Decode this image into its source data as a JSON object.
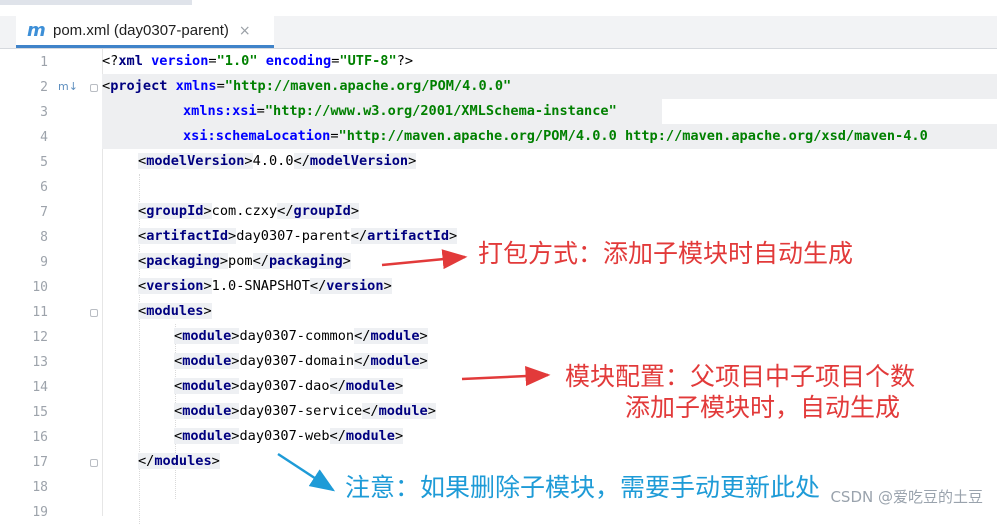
{
  "tab": {
    "icon": "maven-m-icon",
    "title": "pom.xml (day0307-parent)",
    "close": "×"
  },
  "line_numbers": [
    "1",
    "2",
    "3",
    "4",
    "5",
    "6",
    "7",
    "8",
    "9",
    "10",
    "11",
    "12",
    "13",
    "14",
    "15",
    "16",
    "17",
    "18",
    "19"
  ],
  "gutter_marker": "m↓",
  "code": {
    "l1": {
      "open": "<?",
      "name": "xml",
      "a1": "version",
      "v1": "\"1.0\"",
      "a2": "encoding",
      "v2": "\"UTF-8\"",
      "close": "?>"
    },
    "l2": {
      "tag": "project",
      "attr": "xmlns",
      "val": "\"http://maven.apache.org/POM/4.0.0\""
    },
    "l3": {
      "attr": "xmlns:xsi",
      "val": "\"http://www.w3.org/2001/XMLSchema-instance\""
    },
    "l4": {
      "attr": "xsi:schemaLocation",
      "val": "\"http://maven.apache.org/POM/4.0.0 http://maven.apache.org/xsd/maven-4.0"
    },
    "l5": {
      "tag": "modelVersion",
      "text": "4.0.0"
    },
    "l7": {
      "tag": "groupId",
      "text": "com.czxy"
    },
    "l8": {
      "tag": "artifactId",
      "text": "day0307-parent"
    },
    "l9": {
      "tag": "packaging",
      "text": "pom"
    },
    "l10": {
      "tag": "version",
      "text": "1.0-SNAPSHOT"
    },
    "l11": {
      "tag": "modules"
    },
    "module_tag": "module",
    "modules": [
      "day0307-common",
      "day0307-domain",
      "day0307-dao",
      "day0307-service",
      "day0307-web"
    ],
    "l17": {
      "tag": "modules"
    }
  },
  "annotations": {
    "packaging_note": "打包方式：添加子模块时自动生成",
    "modules_note_1": "模块配置：父项目中子项目个数",
    "modules_note_2": "添加子模块时，自动生成",
    "delete_note": "注意：如果删除子模块，需要手动更新此处"
  },
  "watermark": "CSDN @爱吃豆的土豆",
  "colors": {
    "tag": "#000080",
    "attribute": "#0000ff",
    "value": "#008000",
    "annotation_red": "#e23a3a",
    "annotation_blue": "#1e9bd7",
    "tab_underline": "#4083c9"
  }
}
